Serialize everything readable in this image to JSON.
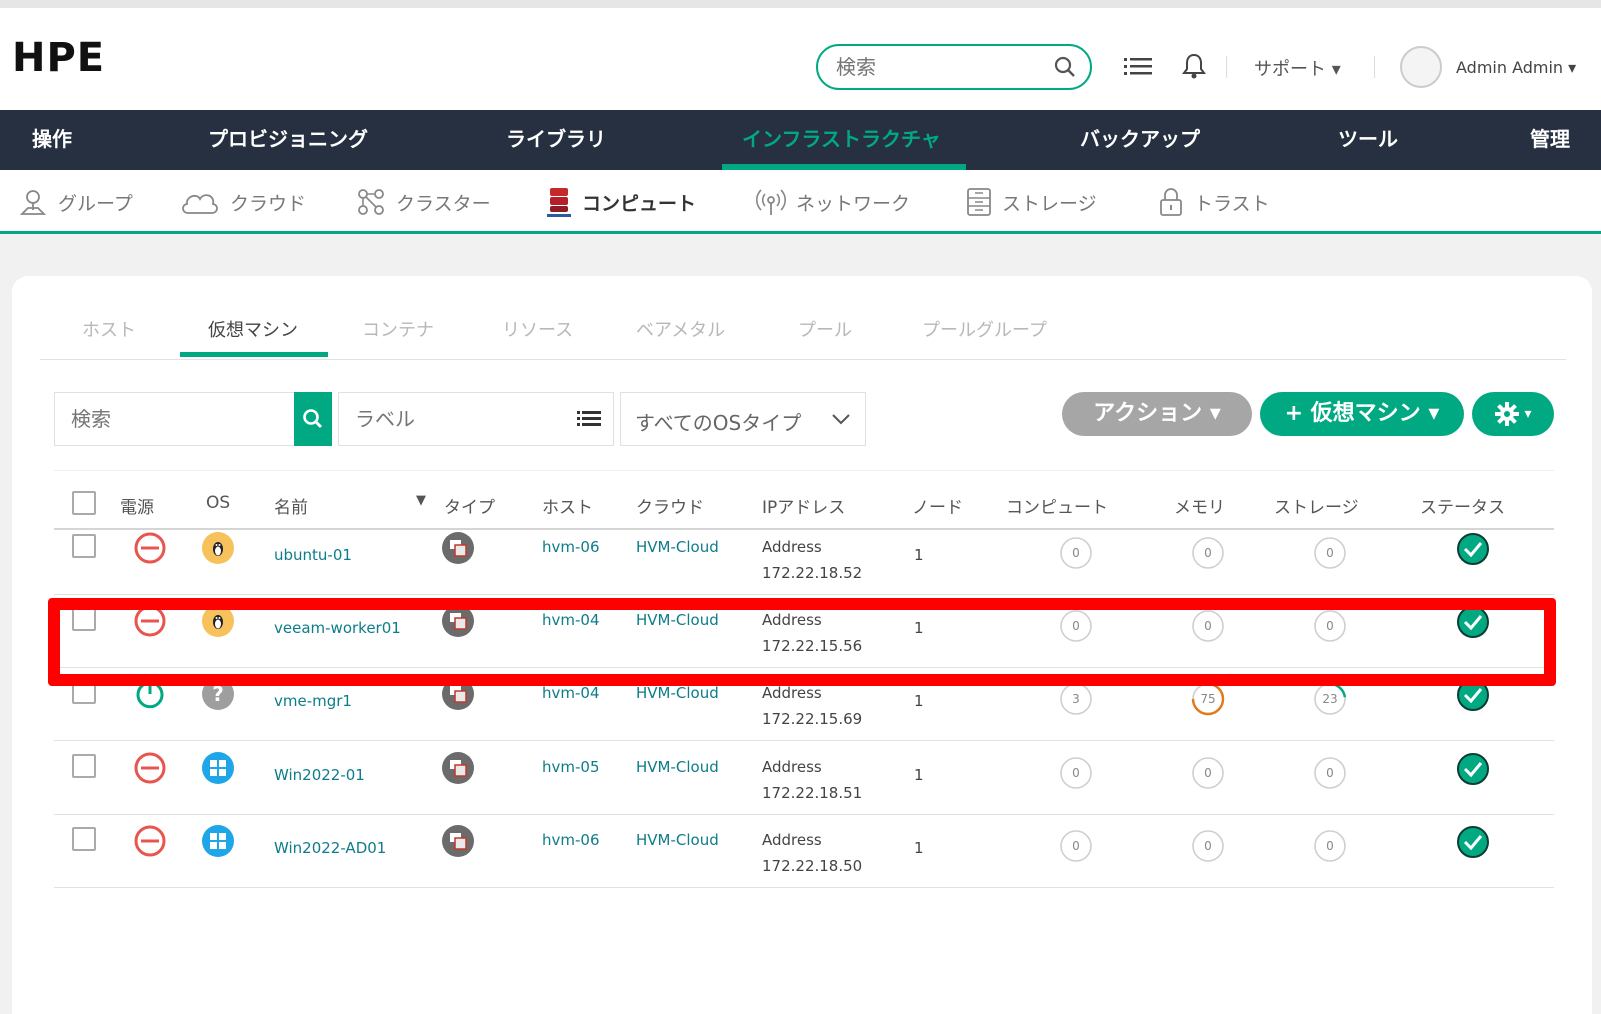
{
  "header": {
    "logo": "HPE",
    "search_placeholder": "検索",
    "support_label": "サポート",
    "user_name": "Admin Admin"
  },
  "main_nav": [
    "操作",
    "プロビジョニング",
    "ライブラリ",
    "インフラストラクチャ",
    "バックアップ",
    "ツール",
    "管理"
  ],
  "main_nav_active": "インフラストラクチャ",
  "sub_nav": [
    {
      "label": "グループ",
      "icon": "group-pin-icon"
    },
    {
      "label": "クラウド",
      "icon": "cloud-icon"
    },
    {
      "label": "クラスター",
      "icon": "cluster-icon"
    },
    {
      "label": "コンピュート",
      "icon": "compute-server-icon"
    },
    {
      "label": "ネットワーク",
      "icon": "network-antenna-icon"
    },
    {
      "label": "ストレージ",
      "icon": "storage-icon"
    },
    {
      "label": "トラスト",
      "icon": "lock-icon"
    }
  ],
  "sub_nav_active": "コンピュート",
  "tabs": [
    "ホスト",
    "仮想マシン",
    "コンテナ",
    "リソース",
    "ベアメタル",
    "プール",
    "プールグループ"
  ],
  "tab_active": "仮想マシン",
  "filters": {
    "search_placeholder": "検索",
    "label_placeholder": "ラベル",
    "os_type": "すべてのOSタイプ"
  },
  "buttons": {
    "action": "アクション",
    "add_vm": "+ 仮想マシン",
    "gear": "gear-icon"
  },
  "columns": [
    "電源",
    "OS",
    "名前",
    "タイプ",
    "ホスト",
    "クラウド",
    "IPアドレス",
    "ノード",
    "コンピュート",
    "メモリ",
    "ストレージ",
    "ステータス"
  ],
  "rows": [
    {
      "power": "off",
      "os": "linux",
      "name": "ubuntu-01",
      "host": "hvm-06",
      "cloud": "HVM-Cloud",
      "ip_label": "Address",
      "ip": "172.22.18.52",
      "nodes": "1",
      "compute": 0,
      "memory": 0,
      "storage": 0,
      "status": "ok"
    },
    {
      "power": "off",
      "os": "linux",
      "name": "veeam-worker01",
      "host": "hvm-04",
      "cloud": "HVM-Cloud",
      "ip_label": "Address",
      "ip": "172.22.15.56",
      "nodes": "1",
      "compute": 0,
      "memory": 0,
      "storage": 0,
      "status": "ok"
    },
    {
      "power": "on",
      "os": "unknown",
      "name": "vme-mgr1",
      "host": "hvm-04",
      "cloud": "HVM-Cloud",
      "ip_label": "Address",
      "ip": "172.22.15.69",
      "nodes": "1",
      "compute": 3,
      "memory": 75,
      "storage": 23,
      "status": "ok"
    },
    {
      "power": "off",
      "os": "windows",
      "name": "Win2022-01",
      "host": "hvm-05",
      "cloud": "HVM-Cloud",
      "ip_label": "Address",
      "ip": "172.22.18.51",
      "nodes": "1",
      "compute": 0,
      "memory": 0,
      "storage": 0,
      "status": "ok"
    },
    {
      "power": "off",
      "os": "windows",
      "name": "Win2022-AD01",
      "host": "hvm-06",
      "cloud": "HVM-Cloud",
      "ip_label": "Address",
      "ip": "172.22.18.50",
      "nodes": "1",
      "compute": 0,
      "memory": 0,
      "storage": 0,
      "status": "ok"
    }
  ],
  "highlighted_row": "veeam-worker01",
  "colors": {
    "accent": "#01a982",
    "nav_bg": "#263040",
    "power_off": "#e8554e",
    "power_on": "#01a982",
    "highlight": "#ff0000",
    "memory_gauge": "#e07b1a"
  }
}
